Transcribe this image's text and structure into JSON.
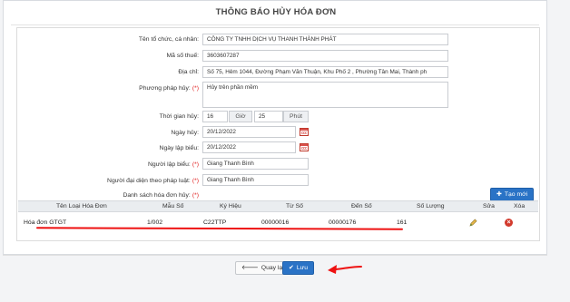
{
  "title": "THÔNG BÁO HỦY HÓA ĐƠN",
  "form": {
    "to_chuc_label": "Tên tổ chức, cá nhân:",
    "to_chuc_value": "CÔNG TY TNHH DỊCH VỤ THANH THÀNH PHÁT",
    "ma_so_thue_label": "Mã số thuế:",
    "ma_so_thue_value": "3603607287",
    "dia_chi_label": "Địa chỉ:",
    "dia_chi_value": "Số 75, Hẻm 1044, Đường Phạm Văn Thuận, Khu Phố 2 , Phường Tân Mai, Thành ph",
    "phuong_phap_label": "Phương pháp hủy:",
    "phuong_phap_value": "Hủy trên phần mềm",
    "thoi_gian_label": "Thời gian hủy:",
    "hour_value": "16",
    "gio_label": "Giờ",
    "minute_value": "25",
    "phut_label": "Phút",
    "ngay_huy_label": "Ngày hủy:",
    "ngay_huy_value": "20/12/2022",
    "ngay_lap_label": "Ngày lập biểu:",
    "ngay_lap_value": "20/12/2022",
    "nguoi_lap_label": "Người lập biểu:",
    "nguoi_lap_value": "Giang Thanh Bình",
    "dai_dien_label": "Người đại diện theo pháp luật:",
    "dai_dien_value": "Giang Thanh Bình",
    "danh_sach_label": "Danh sách hóa đơn hủy:",
    "required_mark": "(*)"
  },
  "buttons": {
    "tao_moi": "Tạo mới",
    "quay_lai": "Quay lại",
    "luu": "Lưu"
  },
  "table": {
    "headers": [
      "Tên Loại Hóa Đơn",
      "Mẫu Số",
      "Ký Hiệu",
      "Từ Số",
      "Đến Số",
      "Số Lượng",
      "Sửa",
      "Xóa"
    ],
    "rows": [
      [
        "Hóa đơn GTGT",
        "1/002",
        "C22TTP",
        "00000016",
        "00000176",
        "161"
      ]
    ]
  },
  "colors": {
    "primary": "#2a73c6",
    "danger": "#d23a2d",
    "annotation": "#e11111"
  }
}
